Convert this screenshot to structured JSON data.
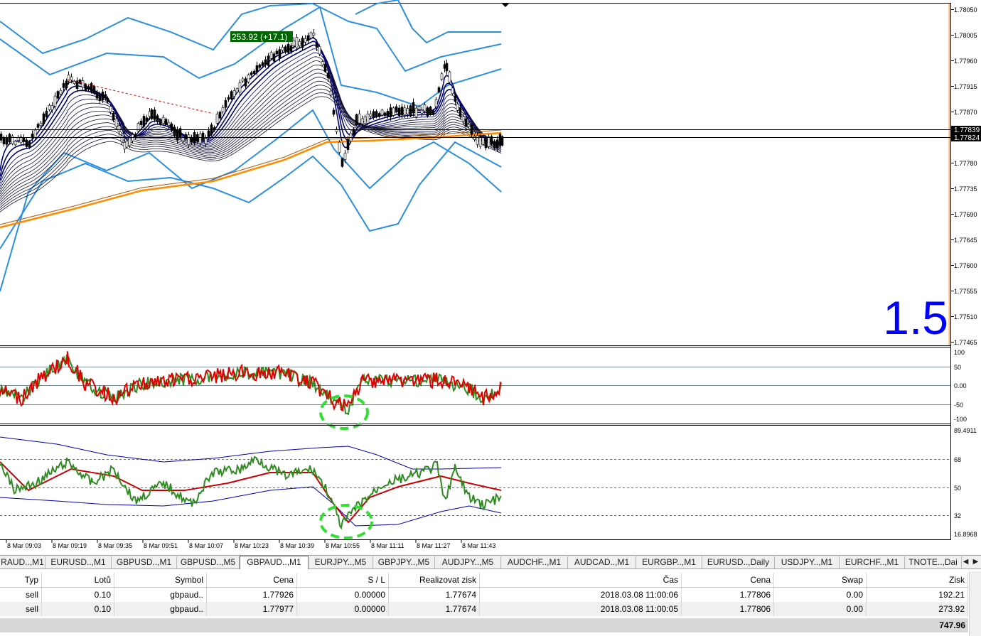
{
  "chart": {
    "main_price_axis": [
      "1.78050",
      "1.78005",
      "1.77960",
      "1.77915",
      "1.77870",
      "1.77825",
      "1.77780",
      "1.77735",
      "1.77690",
      "1.77645",
      "1.77600",
      "1.77555",
      "1.77510",
      "1.77465"
    ],
    "price_tag_upper": "1.77839",
    "price_tag_lower": "1.77824",
    "profit_label": "253.92 (+17.1)",
    "big_label": "1.5",
    "osc1_axis": [
      "100",
      "50",
      "0.00",
      "-50",
      "-100"
    ],
    "osc2_axis": [
      "89.4911",
      "68",
      "50",
      "32",
      "16.8968"
    ],
    "time_axis": [
      "8 Mar 09:03",
      "8 Mar 09:19",
      "8 Mar 09:35",
      "8 Mar 09:51",
      "8 Mar 10:07",
      "8 Mar 10:23",
      "8 Mar 10:39",
      "8 Mar 10:55",
      "8 Mar 11:11",
      "8 Mar 11:27",
      "8 Mar 11:43"
    ],
    "colors": {
      "candles": "#000000",
      "bands": "#2a8fde",
      "ma_fan": "#000080",
      "ma_slow": "#ff8c00",
      "osc_red": "#e00000",
      "osc_green": "#2e8b20",
      "highlight": "#33dd33",
      "profit_bg": "#006400",
      "big_label": "#0000ff",
      "right_edge": "#ffb060"
    }
  },
  "tabs": [
    "RAUD..,M1",
    "EURUSD..,M1",
    "GBPUSD..,M1",
    "GBPUSD..,M5",
    "GBPAUD..,M1",
    "EURJPY..,M5",
    "GBPJPY..,M5",
    "AUDJPY..,M5",
    "AUDCHF..,M1",
    "AUDCAD..,M1",
    "EURGBP..,M1",
    "EURUSD..,Daily",
    "USDJPY..,M1",
    "EURCHF..,M1",
    "TNOTE..,Dai"
  ],
  "active_tab_index": 4,
  "tab_scroll_icons": [
    "arrow-left-icon",
    "arrow-right-icon"
  ],
  "trades": {
    "columns": [
      "Typ",
      "Lotů",
      "Symbol",
      "Cena",
      "S / L",
      "Realizovat zisk",
      "Čas",
      "Cena",
      "Swap",
      "Zisk"
    ],
    "rows": [
      [
        "sell",
        "0.10",
        "gbpaud..",
        "1.77926",
        "0.00000",
        "1.77674",
        "2018.03.08 11:00:06",
        "1.77806",
        "0.00",
        "192.21"
      ],
      [
        "sell",
        "0.10",
        "gbpaud..",
        "1.77977",
        "0.00000",
        "1.77674",
        "2018.03.08 11:00:05",
        "1.77806",
        "0.00",
        "273.92"
      ]
    ],
    "total": "747.96"
  }
}
